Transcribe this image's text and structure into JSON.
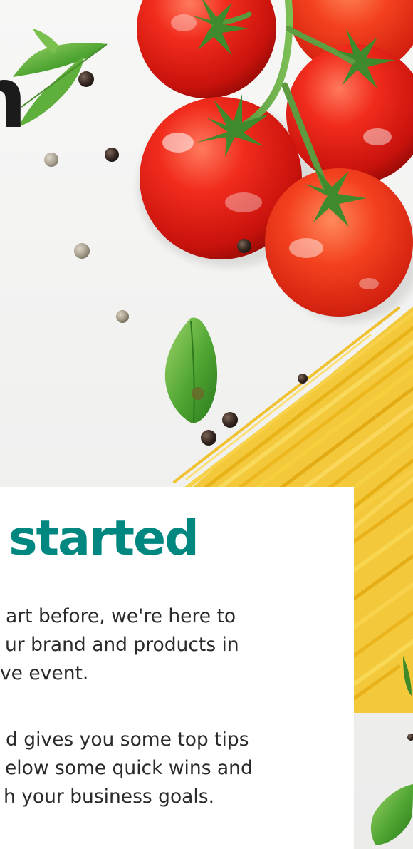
{
  "hero": {
    "headline": "n"
  },
  "card": {
    "heading": "u started",
    "paragraphs": [
      {
        "lines": [
          "art before, we're here to",
          "ur brand and products in",
          "ve event."
        ]
      },
      {
        "lines": [
          "d gives you some top tips",
          "elow some quick wins and",
          "h your business goals."
        ]
      }
    ]
  },
  "colors": {
    "heading": "#00877f",
    "body_text": "#2b2b2b",
    "headline": "#1b1b1b",
    "background": "#f3f3f2",
    "card": "#ffffff",
    "tomato": "#e5211b",
    "basil": "#3f9a2c",
    "spaghetti": "#f2c51e"
  }
}
